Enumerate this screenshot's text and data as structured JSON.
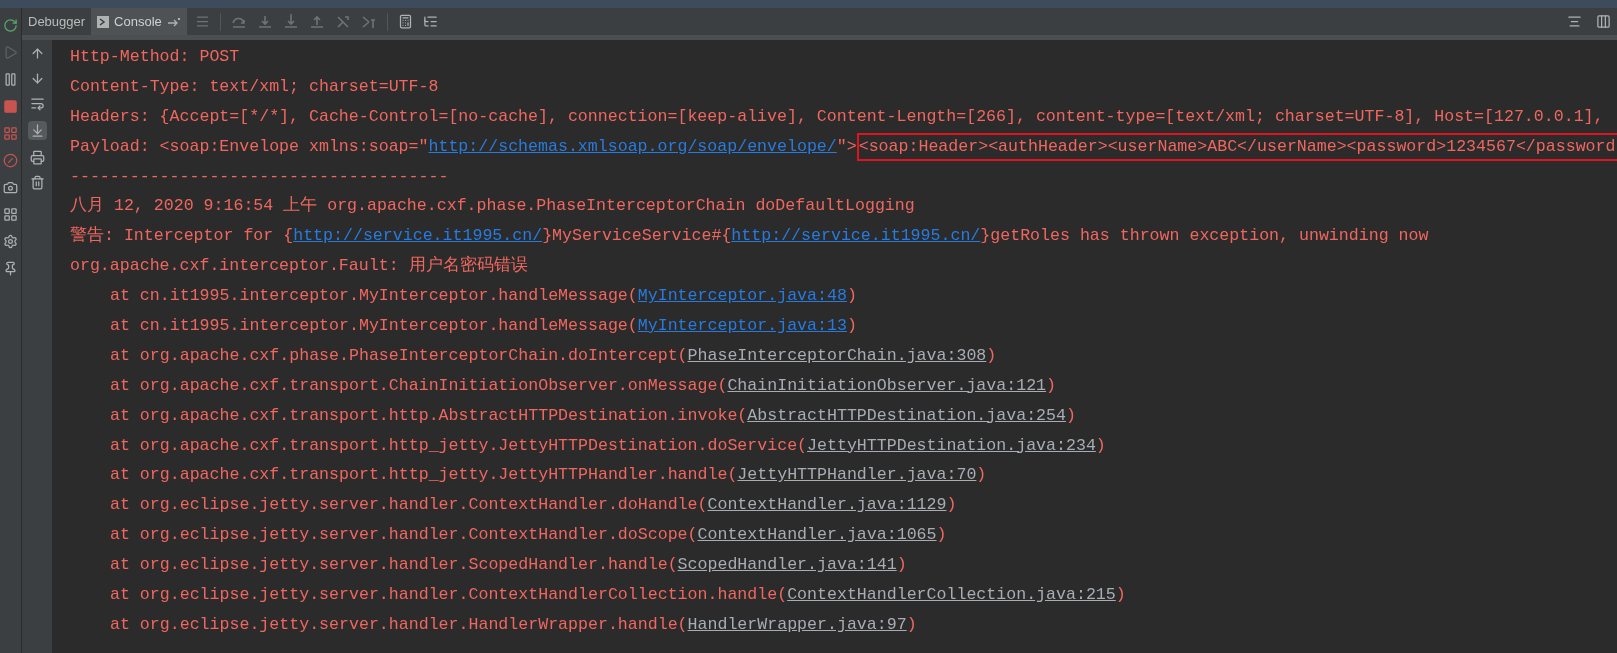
{
  "tabs": [
    {
      "label": "Debugger",
      "selected": false,
      "kind": "plain"
    },
    {
      "label": "Console",
      "selected": true,
      "kind": "console"
    }
  ],
  "console_lines": [
    {
      "kind": "message",
      "segments": [
        {
          "kind": "text",
          "text": "Http-Method: POST"
        }
      ]
    },
    {
      "kind": "message",
      "segments": [
        {
          "kind": "text",
          "text": "Content-Type: text/xml; charset=UTF-8"
        }
      ]
    },
    {
      "kind": "message",
      "segments": [
        {
          "kind": "text",
          "text": "Headers: {Accept=[*/*], Cache-Control=[no-cache], connection=[keep-alive], Content-Length=[266], content-type=[text/xml; charset=UTF-8], Host=[127.0.0.1],"
        }
      ]
    },
    {
      "kind": "message",
      "segments": [
        {
          "kind": "text",
          "text": "Payload: <soap:Envelope xmlns:soap=\""
        },
        {
          "kind": "link",
          "text": "http://schemas.xmlsoap.org/soap/envelope/"
        },
        {
          "kind": "text",
          "text": "\">"
        },
        {
          "kind": "highlighted",
          "text": "<soap:Header><authHeader><userName>ABC</userName><password>1234567</password"
        }
      ]
    },
    {
      "kind": "message",
      "segments": [
        {
          "kind": "text",
          "text": "--------------------------------------"
        }
      ]
    },
    {
      "kind": "message",
      "segments": [
        {
          "kind": "text",
          "text": "八月 12, 2020 9:16:54 上午 org.apache.cxf.phase.PhaseInterceptorChain doDefaultLogging"
        }
      ]
    },
    {
      "kind": "message",
      "segments": [
        {
          "kind": "text",
          "text": "警告: Interceptor for {"
        },
        {
          "kind": "link",
          "text": "http://service.it1995.cn/"
        },
        {
          "kind": "text",
          "text": "}MyServiceService#{"
        },
        {
          "kind": "link",
          "text": "http://service.it1995.cn/"
        },
        {
          "kind": "text",
          "text": "}getRoles has thrown exception, unwinding now"
        }
      ]
    },
    {
      "kind": "message",
      "segments": [
        {
          "kind": "text",
          "text": "org.apache.cxf.interceptor.Fault: 用户名密码错误"
        }
      ]
    },
    {
      "kind": "stack_frame",
      "segments": [
        {
          "kind": "text",
          "text": "at cn.it1995.interceptor.MyInterceptor.handleMessage("
        },
        {
          "kind": "link",
          "text": "MyInterceptor.java:48"
        },
        {
          "kind": "text",
          "text": ")"
        }
      ]
    },
    {
      "kind": "stack_frame",
      "segments": [
        {
          "kind": "text",
          "text": "at cn.it1995.interceptor.MyInterceptor.handleMessage("
        },
        {
          "kind": "link",
          "text": "MyInterceptor.java:13"
        },
        {
          "kind": "text",
          "text": ")"
        }
      ]
    },
    {
      "kind": "stack_frame",
      "segments": [
        {
          "kind": "text",
          "text": "at org.apache.cxf.phase.PhaseInterceptorChain.doIntercept("
        },
        {
          "kind": "library_link",
          "text": "PhaseInterceptorChain.java:308"
        },
        {
          "kind": "text",
          "text": ")"
        }
      ]
    },
    {
      "kind": "stack_frame",
      "segments": [
        {
          "kind": "text",
          "text": "at org.apache.cxf.transport.ChainInitiationObserver.onMessage("
        },
        {
          "kind": "library_link",
          "text": "ChainInitiationObserver.java:121"
        },
        {
          "kind": "text",
          "text": ")"
        }
      ]
    },
    {
      "kind": "stack_frame",
      "segments": [
        {
          "kind": "text",
          "text": "at org.apache.cxf.transport.http.AbstractHTTPDestination.invoke("
        },
        {
          "kind": "library_link",
          "text": "AbstractHTTPDestination.java:254"
        },
        {
          "kind": "text",
          "text": ")"
        }
      ]
    },
    {
      "kind": "stack_frame",
      "segments": [
        {
          "kind": "text",
          "text": "at org.apache.cxf.transport.http_jetty.JettyHTTPDestination.doService("
        },
        {
          "kind": "library_link",
          "text": "JettyHTTPDestination.java:234"
        },
        {
          "kind": "text",
          "text": ")"
        }
      ]
    },
    {
      "kind": "stack_frame",
      "segments": [
        {
          "kind": "text",
          "text": "at org.apache.cxf.transport.http_jetty.JettyHTTPHandler.handle("
        },
        {
          "kind": "library_link",
          "text": "JettyHTTPHandler.java:70"
        },
        {
          "kind": "text",
          "text": ")"
        }
      ]
    },
    {
      "kind": "stack_frame",
      "segments": [
        {
          "kind": "text",
          "text": "at org.eclipse.jetty.server.handler.ContextHandler.doHandle("
        },
        {
          "kind": "library_link",
          "text": "ContextHandler.java:1129"
        },
        {
          "kind": "text",
          "text": ")"
        }
      ]
    },
    {
      "kind": "stack_frame",
      "segments": [
        {
          "kind": "text",
          "text": "at org.eclipse.jetty.server.handler.ContextHandler.doScope("
        },
        {
          "kind": "library_link",
          "text": "ContextHandler.java:1065"
        },
        {
          "kind": "text",
          "text": ")"
        }
      ]
    },
    {
      "kind": "stack_frame",
      "segments": [
        {
          "kind": "text",
          "text": "at org.eclipse.jetty.server.handler.ScopedHandler.handle("
        },
        {
          "kind": "library_link",
          "text": "ScopedHandler.java:141"
        },
        {
          "kind": "text",
          "text": ")"
        }
      ]
    },
    {
      "kind": "stack_frame",
      "segments": [
        {
          "kind": "text",
          "text": "at org.eclipse.jetty.server.handler.ContextHandlerCollection.handle("
        },
        {
          "kind": "library_link",
          "text": "ContextHandlerCollection.java:215"
        },
        {
          "kind": "text",
          "text": ")"
        }
      ]
    },
    {
      "kind": "stack_frame",
      "segments": [
        {
          "kind": "text",
          "text": "at org.eclipse.jetty.server.handler.HandlerWrapper.handle("
        },
        {
          "kind": "library_link",
          "text": "HandlerWrapper.java:97"
        },
        {
          "kind": "text",
          "text": ")"
        }
      ]
    }
  ]
}
